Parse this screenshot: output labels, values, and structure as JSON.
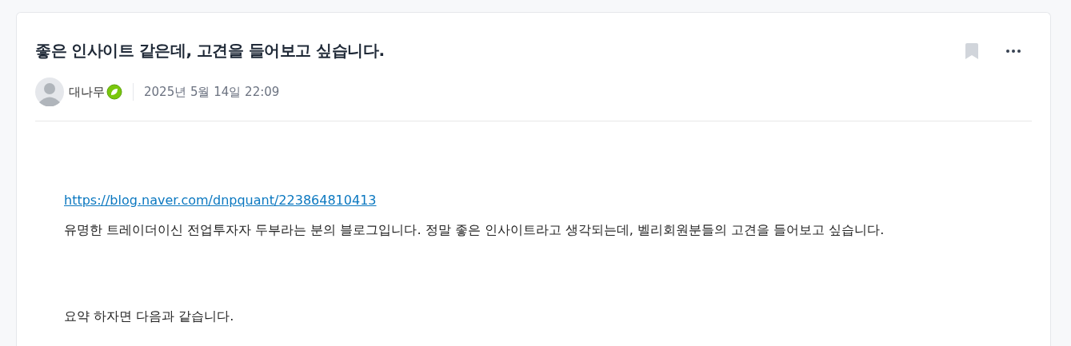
{
  "post": {
    "title": "좋은 인사이트 같은데, 고견을 들어보고 싶습니다.",
    "author": "대나무",
    "date": "2025년 5월 14일 22:09",
    "body": [
      {
        "kind": "link",
        "text": "https://blog.naver.com/dnpquant/223864810413"
      },
      {
        "kind": "text",
        "text": "유명한 트레이더이신 전업투자자 두부라는 분의 블로그입니다. 정말 좋은 인사이트라고 생각되는데, 벨리회원분들의 고견을 들어보고 싶습니다."
      },
      {
        "kind": "gap"
      },
      {
        "kind": "text",
        "text": "요약 하자면 다음과 같습니다."
      }
    ]
  }
}
